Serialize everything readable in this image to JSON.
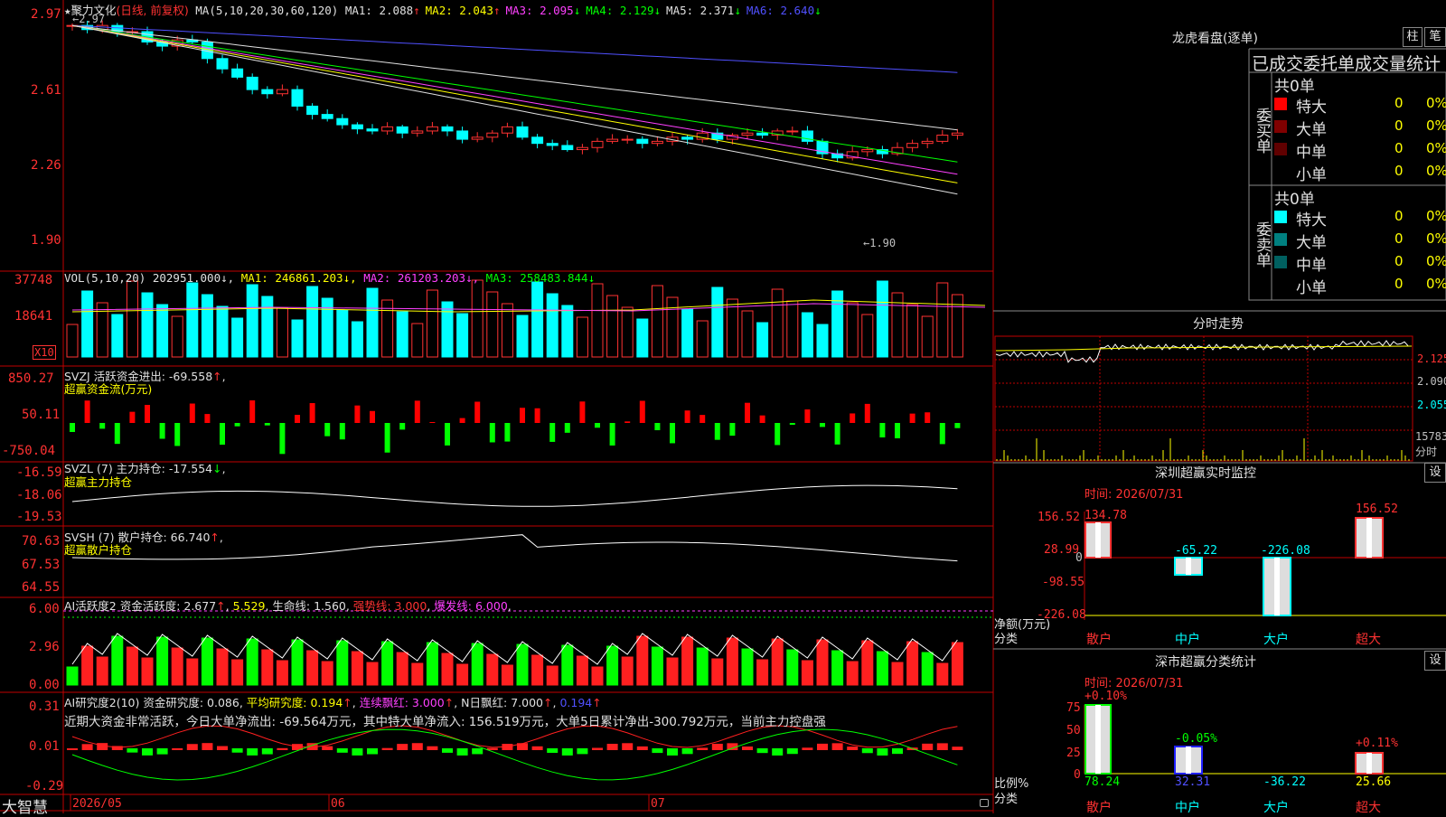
{
  "main": {
    "star": "★",
    "stock_name": "聚力文化",
    "period": "(日线, 前复权)",
    "ma_prefix": "MA(5,10,20,30,60,120)",
    "ma": [
      {
        "label": "MA1:",
        "value": "2.088",
        "dir": "↑",
        "color": "#e0e0e0"
      },
      {
        "label": "MA2:",
        "value": "2.043",
        "dir": "↑",
        "color": "#ffff00"
      },
      {
        "label": "MA3:",
        "value": "2.095",
        "dir": "↓",
        "color": "#ff40ff"
      },
      {
        "label": "MA4:",
        "value": "2.129",
        "dir": "↓",
        "color": "#00ff00"
      },
      {
        "label": "MA5:",
        "value": "2.371",
        "dir": "↓",
        "color": "#e0e0e0"
      },
      {
        "label": "MA6:",
        "value": "2.640",
        "dir": "↓",
        "color": "#5050ff"
      }
    ],
    "y_ticks": [
      "2.97",
      "2.61",
      "2.26",
      "1.90"
    ],
    "high_label": "2.97",
    "low_label": "1.90"
  },
  "vol": {
    "header": "VOL(5,10,20)",
    "value": "202951.000",
    "ma1": "MA1: 246861.203",
    "ma2": "MA2: 261203.203",
    "ma3": "MA3: 258483.844",
    "y_ticks": [
      "37748",
      "18641"
    ],
    "unit": "X10"
  },
  "svzj": {
    "header": "SVZJ  活跃资金进出: -69.558",
    "dir": "↑",
    "sub": "超赢资金流(万元)",
    "y_ticks": [
      "850.27",
      "50.11",
      "-750.04"
    ]
  },
  "svzl": {
    "header": "SVZL (7) 主力持仓: -17.554",
    "dir": "↓",
    "sub": "超赢主力持仓",
    "y_ticks": [
      "-16.59",
      "-18.06",
      "-19.53"
    ]
  },
  "svsh": {
    "header": "SVSH (7) 散户持仓: 66.740",
    "dir": "↑",
    "sub": "超赢散户持仓",
    "y_ticks": [
      "70.63",
      "67.53",
      "64.55"
    ]
  },
  "ai1": {
    "name": "AI活跃度2",
    "a": "资金活跃度: 2.677",
    "b": "5.529",
    "c": "生命线: 1.560",
    "d": "强势线: 3.000",
    "e": "爆发线: 6.000",
    "y_ticks": [
      "6.00",
      "2.96",
      "0.00"
    ]
  },
  "ai2": {
    "name": "AI研究度2(10)",
    "a": "资金研究度: 0.086",
    "b": "平均研究度: 0.194",
    "c": "连续飘红: 3.000",
    "d": "N日飘红: 7.000",
    "e": "0.194",
    "comment": "近期大资金非常活跃，今日大单净流出: -69.564万元，其中特大单净流入: 156.519万元，大单5日累计净出-300.792万元，当前主力控盘强",
    "y_ticks": [
      "0.31",
      "0.01",
      "-0.29"
    ]
  },
  "bottom": {
    "brand": "大智慧",
    "dates": [
      "2026/05",
      "06",
      "07"
    ]
  },
  "right": {
    "title": "龙虎看盘(逐单)",
    "btn1": "柱",
    "btn2": "笔",
    "stat_title": "已成交委托单成交量统计",
    "buy_label": "委买单",
    "sell_label": "委卖单",
    "buy_total": "共0单",
    "sell_total": "共0单",
    "buy_rows": [
      {
        "name": "特大",
        "n": "0",
        "p": "0%",
        "color": "#ff0000"
      },
      {
        "name": "大单",
        "n": "0",
        "p": "0%",
        "color": "#800000"
      },
      {
        "name": "中单",
        "n": "0",
        "p": "0%",
        "color": "#600000"
      },
      {
        "name": "小单",
        "n": "0",
        "p": "0%",
        "color": "#000000"
      }
    ],
    "sell_rows": [
      {
        "name": "特大",
        "n": "0",
        "p": "0%",
        "color": "#00ffff"
      },
      {
        "name": "大单",
        "n": "0",
        "p": "0%",
        "color": "#008080"
      },
      {
        "name": "中单",
        "n": "0",
        "p": "0%",
        "color": "#006060"
      },
      {
        "name": "小单",
        "n": "0",
        "p": "0%",
        "color": "#000000"
      }
    ],
    "intraday_title": "分时走势",
    "intraday_ticks": [
      "2.125",
      "2.090",
      "2.055",
      "15783",
      "分时"
    ],
    "sz_title": "深圳超赢实时监控",
    "sz_btn": "设",
    "sz_time": "时间: 2026/07/31",
    "sz_ticks": [
      "156.52",
      "28.99",
      "0",
      "-98.55",
      "-226.08"
    ],
    "sz_values": [
      "134.78",
      "-65.22",
      "-226.08",
      "156.52"
    ],
    "sz_unit1": "净额(万元)",
    "sz_unit2": "分类",
    "cats": [
      "散户",
      "中户",
      "大户",
      "超大"
    ],
    "cls_title": "深市超赢分类统计",
    "cls_btn": "设",
    "cls_time": "时间: 2026/07/31",
    "cls_ticks": [
      "75",
      "50",
      "25",
      "0"
    ],
    "cls_pct": [
      "+0.10%",
      "-0.05%",
      "+0.11%"
    ],
    "cls_values": [
      "78.24",
      "32.31",
      "-36.22",
      "25.66"
    ],
    "cls_unit1": "比例%",
    "cls_unit2": "分类"
  }
}
